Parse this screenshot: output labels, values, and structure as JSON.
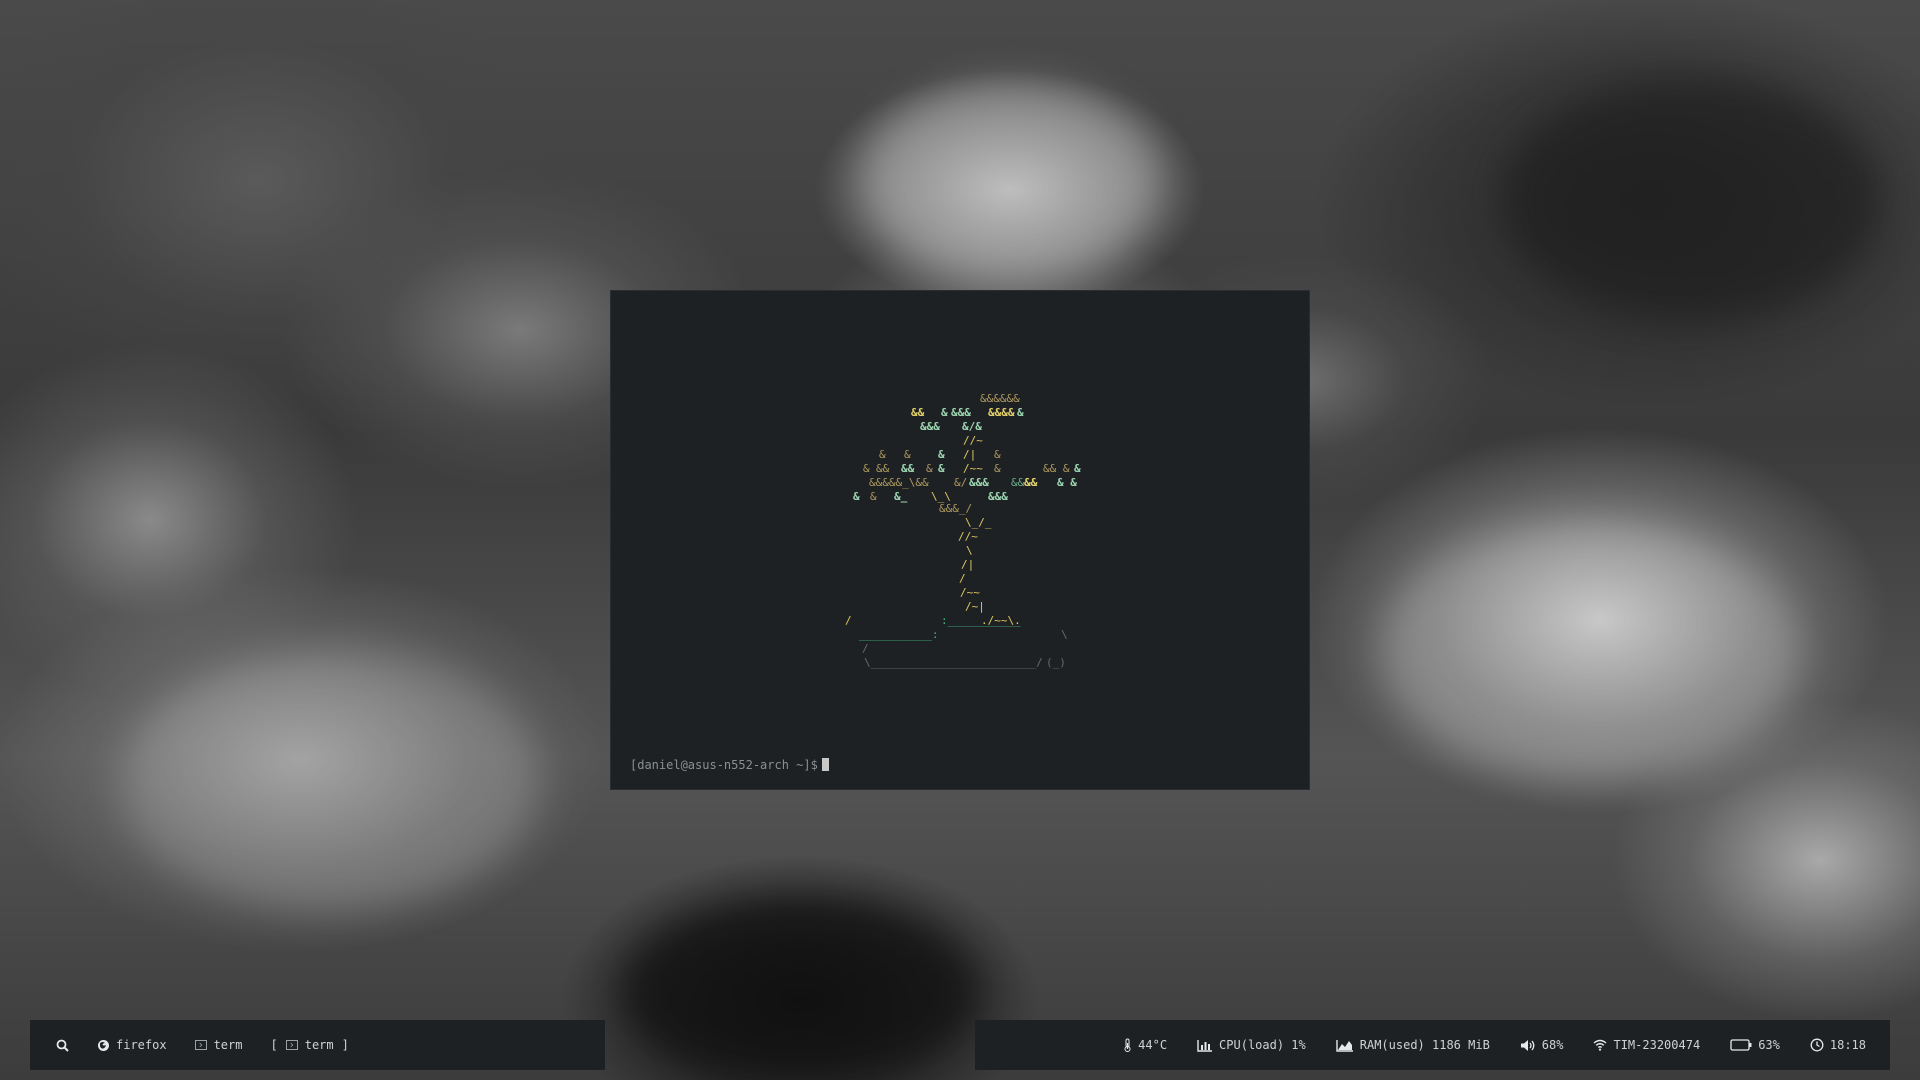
{
  "terminal": {
    "prompt": "[daniel@asus-n552-arch ~]$"
  },
  "bonsai_art": [
    {
      "t": "&&&&&&",
      "c": "leaf-o"
    },
    {
      "t": "&&",
      "c": "leaf-y"
    },
    {
      "t": "&",
      "c": "leaf-l"
    },
    {
      "t": "&&&",
      "c": "leaf-l"
    },
    {
      "t": "&&&&",
      "c": "leaf-y"
    },
    {
      "t": "&",
      "c": "leaf-l"
    },
    {
      "t": "&&&",
      "c": "leaf-l"
    },
    {
      "t": "&/&",
      "c": "leaf-l"
    },
    {
      "t": "//~",
      "c": "trunk"
    },
    {
      "t": "&",
      "c": "leaf-o"
    },
    {
      "t": "&",
      "c": "leaf-o"
    },
    {
      "t": "&",
      "c": "leaf-l"
    },
    {
      "t": "/|",
      "c": "trunk"
    },
    {
      "t": "&",
      "c": "leaf-o"
    },
    {
      "t": "&",
      "c": "leaf-o"
    },
    {
      "t": "&&",
      "c": "leaf-o"
    },
    {
      "t": "&&",
      "c": "leaf-l"
    },
    {
      "t": "&",
      "c": "leaf-o"
    },
    {
      "t": "&",
      "c": "leaf-l"
    },
    {
      "t": "/~~",
      "c": "trunk"
    },
    {
      "t": "&",
      "c": "leaf-o"
    },
    {
      "t": "&& &",
      "c": "leaf-o"
    },
    {
      "t": "&",
      "c": "leaf-l"
    },
    {
      "t": "&&&&&_\\&&",
      "c": "leaf-o"
    },
    {
      "t": "&/",
      "c": "leaf-o"
    },
    {
      "t": "&&&",
      "c": "leaf-l"
    },
    {
      "t": "&&&&",
      "c": "leaf-g"
    },
    {
      "t": "&&",
      "c": "leaf-y"
    },
    {
      "t": "& &",
      "c": "leaf-l"
    },
    {
      "t": "&",
      "c": "leaf-l"
    },
    {
      "t": "&",
      "c": "leaf-o"
    },
    {
      "t": "&_",
      "c": "leaf-l"
    },
    {
      "t": "\\_\\",
      "c": "trunk"
    },
    {
      "t": "&&&",
      "c": "leaf-l"
    },
    {
      "t": "&&&_/",
      "c": "leaf-o"
    },
    {
      "t": "\\_/_",
      "c": "trunk"
    },
    {
      "t": "//~",
      "c": "trunk"
    },
    {
      "t": "\\",
      "c": "trunk"
    },
    {
      "t": "/|",
      "c": "trunk"
    },
    {
      "t": "/",
      "c": "trunk"
    },
    {
      "t": "/~~",
      "c": "trunk"
    },
    {
      "t": "/~|",
      "c": "trunk"
    },
    {
      "t": "/",
      "c": "trunk"
    },
    {
      "t": ":___________",
      "c": "pot-l"
    },
    {
      "t": "./~~\\.",
      "c": "trunk"
    },
    {
      "t": "___________:",
      "c": "pot-l"
    },
    {
      "t": "\\",
      "c": "pot-r"
    },
    {
      "t": "/",
      "c": "pot-r"
    },
    {
      "t": "\\_________________________/",
      "c": "pot-r"
    },
    {
      "t": "(_)",
      "c": "pot-r"
    },
    {
      "t": "(_)",
      "c": "pot-r"
    }
  ],
  "left_bar": {
    "search_icon": "search-icon",
    "items": [
      {
        "label": "firefox",
        "icon": "firefox-icon"
      },
      {
        "label": "term",
        "icon": "terminal-icon"
      },
      {
        "label": "term",
        "icon": "terminal-icon",
        "active": true
      }
    ],
    "bracket_open": "[",
    "bracket_close": "]"
  },
  "right_bar": {
    "temperature": "44°C",
    "cpu": "CPU(load) 1%",
    "ram": "RAM(used) 1186 MiB",
    "volume": "68%",
    "wifi": "TIM-23200474",
    "battery": "63%",
    "clock": "18:18"
  }
}
